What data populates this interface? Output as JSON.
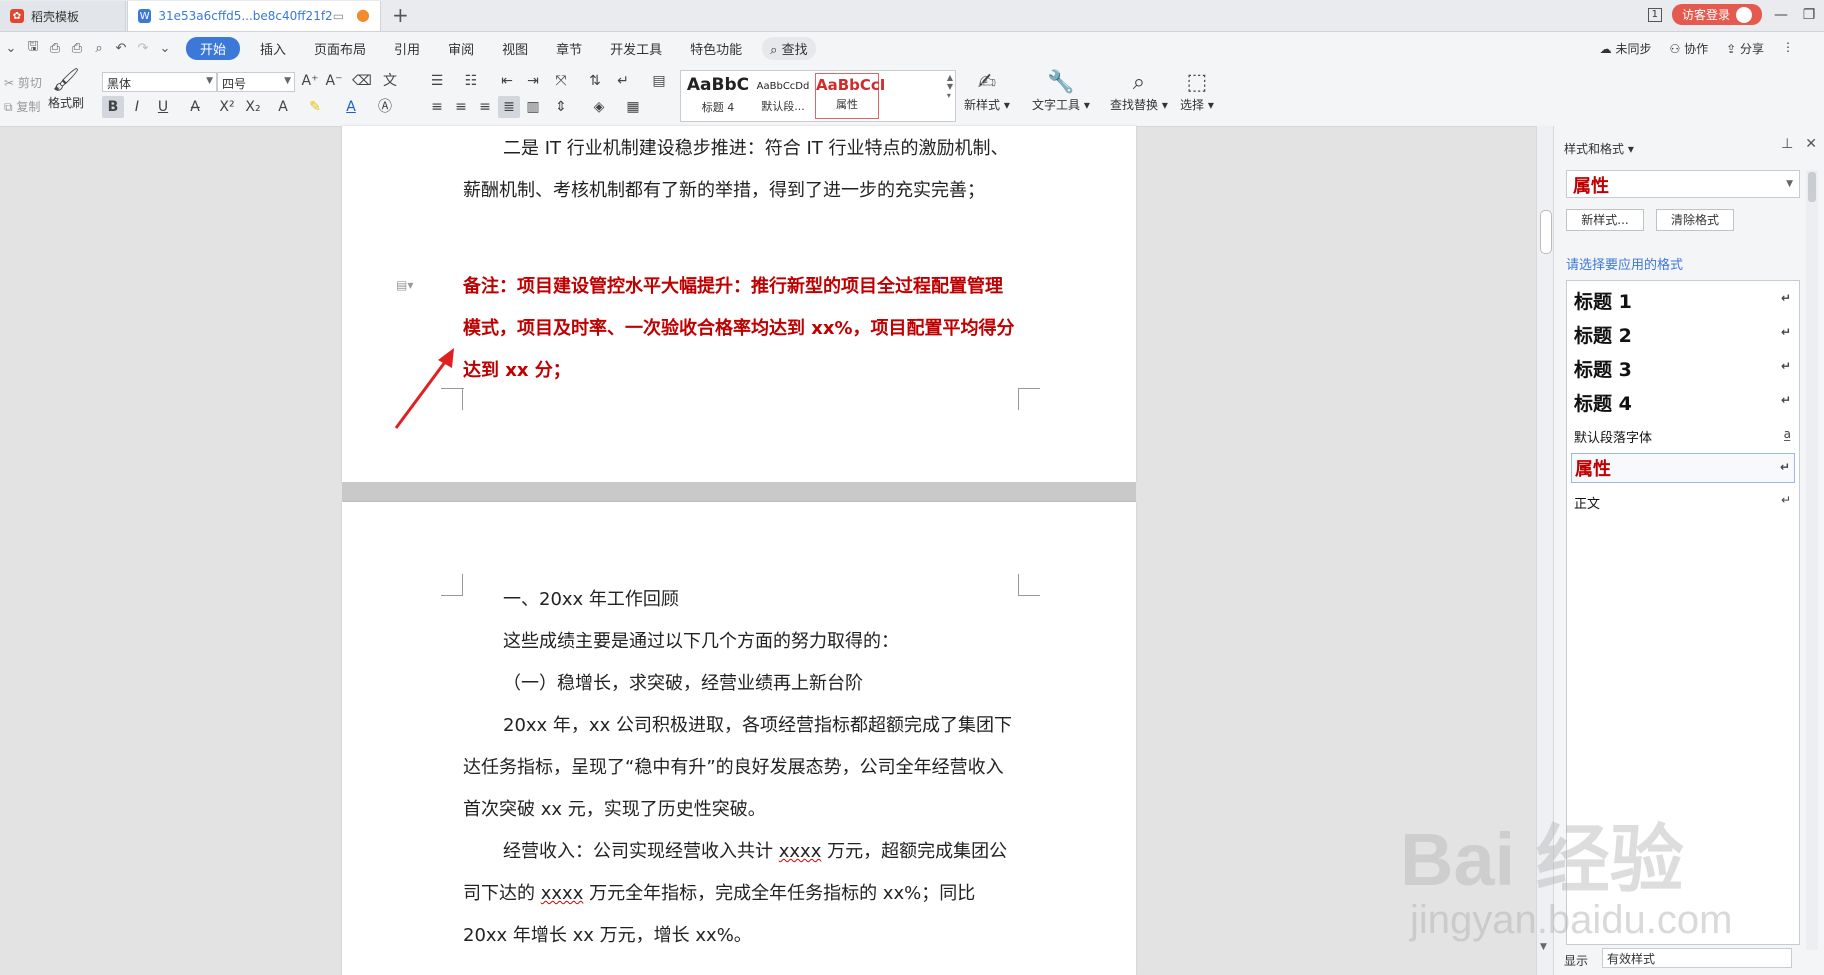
{
  "tabs": [
    {
      "label": "稻壳模板"
    },
    {
      "label": "31e53a6cffd5...be8c40ff21f2"
    }
  ],
  "titlebar": {
    "login_label": "访客登录",
    "box_num": "1"
  },
  "menu": {
    "items": [
      "开始",
      "插入",
      "页面布局",
      "引用",
      "审阅",
      "视图",
      "章节",
      "开发工具",
      "特色功能"
    ],
    "search_label": "查找",
    "right": [
      "未同步",
      "协作",
      "分享"
    ]
  },
  "ribbon": {
    "cut_label": "剪切",
    "copy_label": "复制",
    "format_painter_label": "格式刷",
    "font_name": "黑体",
    "font_size": "四号",
    "styles": [
      {
        "sample": "AaBbC",
        "label": "标题 4"
      },
      {
        "sample": "AaBbCcDd",
        "label": "默认段..."
      },
      {
        "sample": "AaBbCcI",
        "label": "属性"
      }
    ],
    "new_style_label": "新样式",
    "text_tools_label": "文字工具",
    "find_replace_label": "查找替换",
    "select_label": "选择"
  },
  "document": {
    "p1": "二是 IT 行业机制建设稳步推进：符合 IT 行业特点的激励机制、薪酬机制、考核机制都有了新的举措，得到了进一步的充实完善；",
    "note": "备注：项目建设管控水平大幅提升：推行新型的项目全过程配置管理模式，项目及时率、一次验收合格率均达到 xx%，项目配置平均得分达到 xx 分；",
    "h1": "一、20xx 年工作回顾",
    "p2": "这些成绩主要是通过以下几个方面的努力取得的：",
    "h2": "（一）稳增长，求突破，经营业绩再上新台阶",
    "p3": "20xx 年，xx 公司积极进取，各项经营指标都超额完成了集团下达任务指标，呈现了“稳中有升”的良好发展态势，公司全年经营收入首次突破 xx 元，实现了历史性突破。",
    "p4_a": "经营收入：公司实现经营收入共计 ",
    "p4_b": "xxxx",
    "p4_c": " 万元，超额完成集团公司下达的 ",
    "p4_d": "xxxx",
    "p4_e": " 万元全年指标，完成全年任务指标的 xx%；同比 20xx 年增长 xx 万元，增长 xx%。"
  },
  "panel": {
    "title": "样式和格式",
    "current_style": "属性",
    "new_style_btn": "新样式...",
    "clear_format_btn": "清除格式",
    "choose_label": "请选择要应用的格式",
    "styles": [
      {
        "label": "标题  1",
        "kind": "h"
      },
      {
        "label": "标题  2",
        "kind": "h"
      },
      {
        "label": "标题  3",
        "kind": "h"
      },
      {
        "label": "标题  4",
        "kind": "h"
      },
      {
        "label": "默认段落字体",
        "kind": "small"
      },
      {
        "label": "属性",
        "kind": "sel"
      },
      {
        "label": "正文",
        "kind": "small"
      }
    ],
    "show_label": "显示",
    "show_value": "有效样式"
  },
  "watermark": {
    "brand": "Bai 经验",
    "url": "jingyan.baidu.com"
  },
  "colors": {
    "accent": "#3c78d8",
    "note_red": "#c00000",
    "login_red": "#e55a4f"
  }
}
